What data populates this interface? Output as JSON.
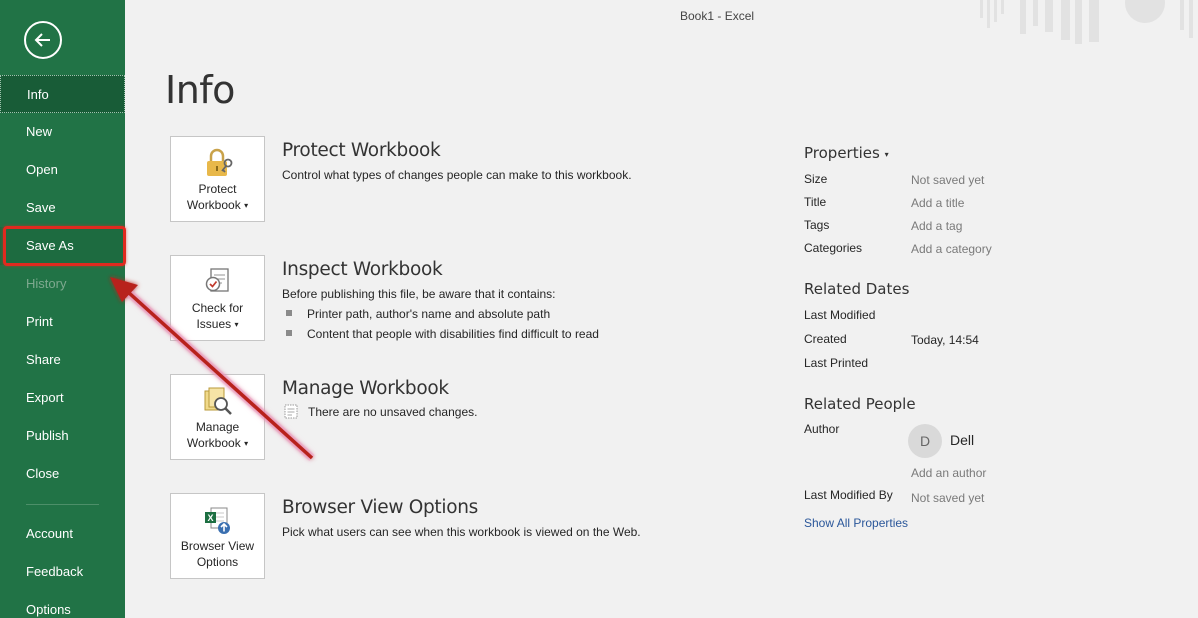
{
  "window": {
    "title": "Book1  -  Excel"
  },
  "sidebar": {
    "back_icon": "back-arrow-icon",
    "items": [
      {
        "label": "Info"
      },
      {
        "label": "New"
      },
      {
        "label": "Open"
      },
      {
        "label": "Save"
      },
      {
        "label": "Save As"
      },
      {
        "label": "History"
      },
      {
        "label": "Print"
      },
      {
        "label": "Share"
      },
      {
        "label": "Export"
      },
      {
        "label": "Publish"
      },
      {
        "label": "Close"
      },
      {
        "label": "Account"
      },
      {
        "label": "Feedback"
      },
      {
        "label": "Options"
      }
    ]
  },
  "main": {
    "title": "Info",
    "sections": [
      {
        "tile_label_1": "Protect",
        "tile_label_2": "Workbook",
        "heading": "Protect Workbook",
        "description": "Control what types of changes people can make to this workbook."
      },
      {
        "tile_label_1": "Check for",
        "tile_label_2": "Issues",
        "heading": "Inspect Workbook",
        "description": "Before publishing this file, be aware that it contains:",
        "bullets": [
          "Printer path, author's name and absolute path",
          "Content that people with disabilities find difficult to read"
        ]
      },
      {
        "tile_label_1": "Manage",
        "tile_label_2": "Workbook",
        "heading": "Manage Workbook",
        "status": "There are no unsaved changes."
      },
      {
        "tile_label_1": "Browser View",
        "tile_label_2": "Options",
        "heading": "Browser View Options",
        "description": "Pick what users can see when this workbook is viewed on the Web."
      }
    ]
  },
  "properties": {
    "heading": "Properties",
    "fields": [
      {
        "label": "Size",
        "value": "Not saved yet"
      },
      {
        "label": "Title",
        "value": "Add a title"
      },
      {
        "label": "Tags",
        "value": "Add a tag"
      },
      {
        "label": "Categories",
        "value": "Add a category"
      }
    ],
    "related_dates": {
      "heading": "Related Dates",
      "last_modified_label": "Last Modified",
      "created_label": "Created",
      "created_value": "Today, 14:54",
      "last_printed_label": "Last Printed"
    },
    "related_people": {
      "heading": "Related People",
      "author_label": "Author",
      "author_initial": "D",
      "author_name": "Dell",
      "add_author": "Add an author",
      "last_modified_by_label": "Last Modified By",
      "last_modified_by_value": "Not saved yet"
    },
    "show_all": "Show All Properties"
  },
  "annotation": {
    "highlight_color": "#e02a1f",
    "arrow_color": "#b8201a"
  }
}
